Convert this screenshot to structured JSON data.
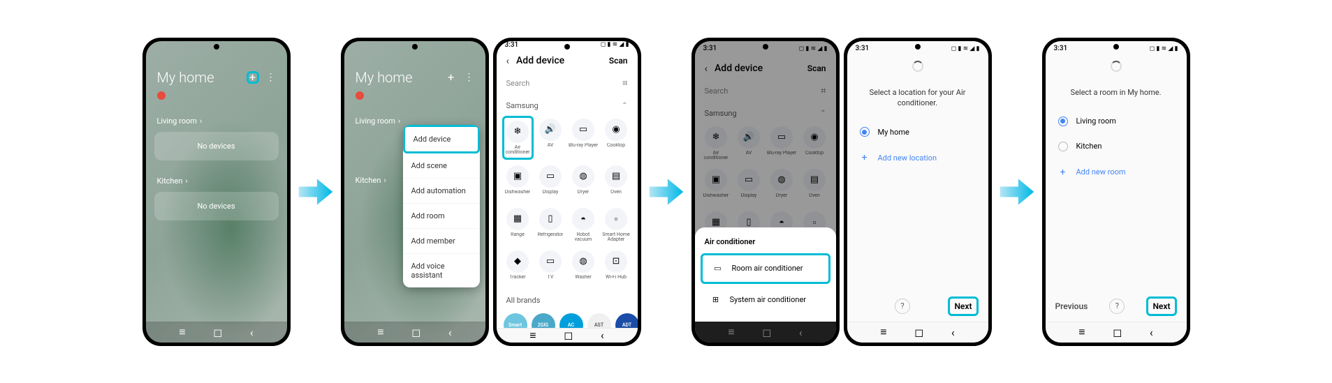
{
  "status": {
    "time": "3:31",
    "icons": "◻ ▮ ≋ ◢ ▮"
  },
  "home": {
    "title": "My home",
    "add_menu": [
      "Add device",
      "Add scene",
      "Add automation",
      "Add room",
      "Add member",
      "Add voice assistant"
    ],
    "rooms": [
      {
        "name": "Living room",
        "empty_text": "No devices"
      },
      {
        "name": "Kitchen",
        "empty_text": "No devices"
      }
    ]
  },
  "add_device": {
    "title": "Add device",
    "scan": "Scan",
    "search_placeholder": "Search",
    "brand_section": "Samsung",
    "all_brands": "All brands",
    "devices": [
      {
        "label": "Air conditioner",
        "icon": "❄"
      },
      {
        "label": "AV",
        "icon": "🔊"
      },
      {
        "label": "Blu-ray Player",
        "icon": "▭"
      },
      {
        "label": "Cooktop",
        "icon": "◉"
      },
      {
        "label": "Dishwasher",
        "icon": "▣"
      },
      {
        "label": "Display",
        "icon": "▭"
      },
      {
        "label": "Dryer",
        "icon": "◍"
      },
      {
        "label": "Oven",
        "icon": "▤"
      },
      {
        "label": "Range",
        "icon": "▦"
      },
      {
        "label": "Refrigerator",
        "icon": "▯"
      },
      {
        "label": "Robot vacuum",
        "icon": "◓"
      },
      {
        "label": "Smart Home Adapter",
        "icon": "▫"
      },
      {
        "label": "Tracker",
        "icon": "◆"
      },
      {
        "label": "TV",
        "icon": "▭"
      },
      {
        "label": "Washer",
        "icon": "◍"
      },
      {
        "label": "Wi-Fi Hub",
        "icon": "⊡"
      }
    ],
    "brands": [
      {
        "label": "SmartThings",
        "color": "#6ec5e0"
      },
      {
        "label": "2GIG",
        "color": "#4aa8c9"
      },
      {
        "label": "AC",
        "color": "#009fdb"
      },
      {
        "label": "AST",
        "color": "#f0f0f0",
        "text": "#555"
      },
      {
        "label": "ADT",
        "color": "#1b4da8"
      }
    ]
  },
  "ac_sheet": {
    "title": "Air conditioner",
    "options": [
      {
        "label": "Room air conditioner",
        "icon": "▭"
      },
      {
        "label": "System air conditioner",
        "icon": "⊞"
      }
    ]
  },
  "select_location": {
    "instruction": "Select a location for your Air conditioner.",
    "options": [
      {
        "label": "My home",
        "selected": true
      }
    ],
    "add_new": "Add new location",
    "next": "Next"
  },
  "select_room": {
    "instruction": "Select a room in My home.",
    "options": [
      {
        "label": "Living room",
        "selected": true
      },
      {
        "label": "Kitchen",
        "selected": false
      }
    ],
    "add_new": "Add new room",
    "previous": "Previous",
    "next": "Next"
  }
}
